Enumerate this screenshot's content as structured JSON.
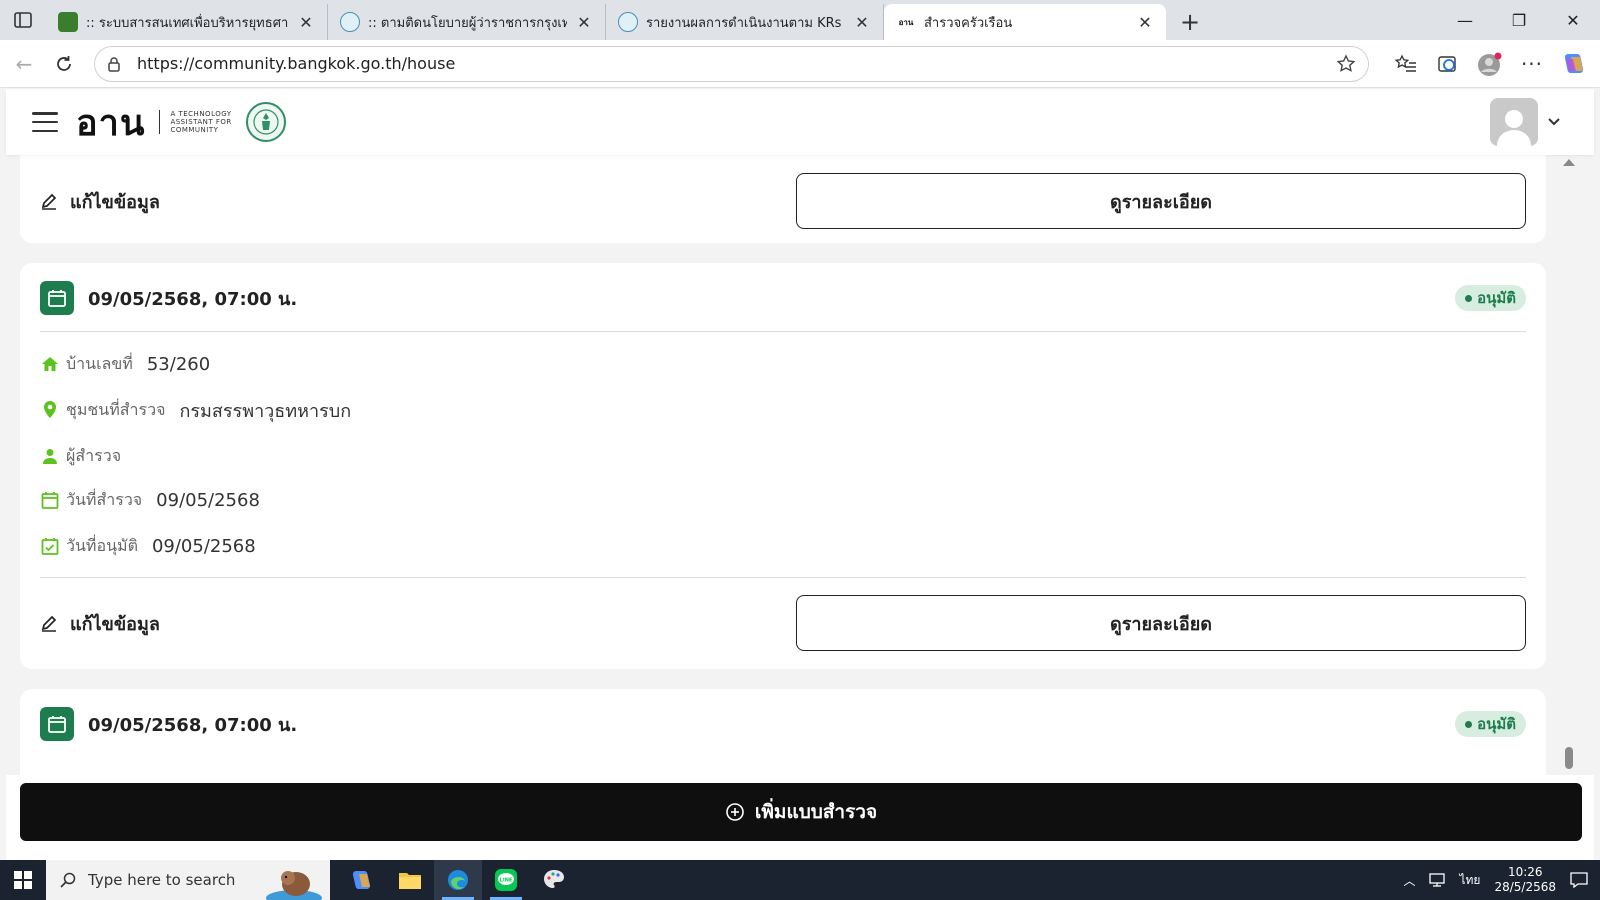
{
  "browser": {
    "tabs": [
      {
        "title": ":: ระบบสารสนเทศเพื่อบริหารยุทธศาสตร์",
        "favicon_color": "#3a7d2c",
        "active": false
      },
      {
        "title": ":: ตามติดนโยบายผู้ว่าราชการกรุงเทพมหานคร",
        "favicon_color": "#4a8fb8",
        "active": false
      },
      {
        "title": "รายงานผลการดำเนินงานตาม KRs",
        "favicon_color": "#4a8fb8",
        "active": false
      },
      {
        "title": "สำรวจครัวเรือน",
        "favicon_color": "#ffffff",
        "favicon_text": " อาน",
        "active": true
      }
    ],
    "url": "https://community.bangkok.go.th/house"
  },
  "app": {
    "logo_word": "อาน",
    "logo_tag_line1": "A TECHNOLOGY",
    "logo_tag_line2": "ASSISTANT FOR",
    "logo_tag_line3": "COMMUNITY",
    "brand_color": "#1e7d4e",
    "accent_icon_color": "#5cc21d"
  },
  "cards": [
    {
      "partial": true,
      "edit_label": "แก้ไขข้อมูล",
      "detail_label": "ดูรายละเอียด"
    },
    {
      "date": "09/05/2568, 07:00 น.",
      "status": "อนุมัติ",
      "house_no_label": "บ้านเลขที่",
      "house_no": "53/260",
      "community_label": "ชุมชนที่สำรวจ",
      "community": "กรมสรรพาวุธทหารบก",
      "surveyor_label": "ผู้สำรวจ",
      "surveyor": "",
      "survey_date_label": "วันที่สำรวจ",
      "survey_date": "09/05/2568",
      "approve_date_label": "วันที่อนุมัติ",
      "approve_date": "09/05/2568",
      "edit_label": "แก้ไขข้อมูล",
      "detail_label": "ดูรายละเอียด"
    },
    {
      "date": "09/05/2568, 07:00 น.",
      "status": "อนุมัติ"
    }
  ],
  "add_button_label": "เพิ่มแบบสำรวจ",
  "taskbar": {
    "search_placeholder": "Type here to search",
    "language": "ไทย",
    "time": "10:26",
    "date": "28/5/2568"
  }
}
